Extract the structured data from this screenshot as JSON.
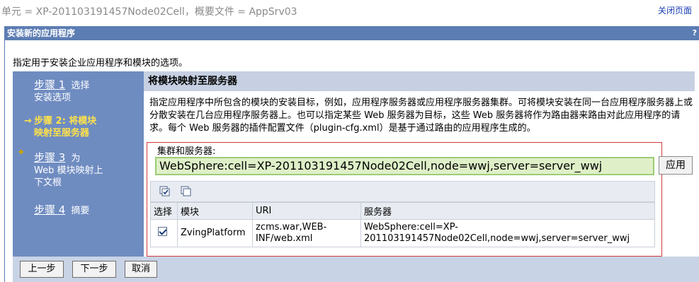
{
  "header": {
    "scope_text": "单元 = XP-201103191457Node02Cell，概要文件 = AppSrv03",
    "close_page": "关闭页面"
  },
  "titlebar": {
    "title": "安装新的应用程序",
    "help": "?"
  },
  "intro": "指定用于安装企业应用程序和模块的选项。",
  "steps": [
    {
      "num": "步骤 1",
      "label_line1": "选择",
      "label_line2": "安装选项"
    },
    {
      "label_line1": "步骤 2: 将模块",
      "label_line2": "映射至服务器",
      "arrow": "→"
    },
    {
      "num": "步骤 3",
      "label_line1": "为",
      "label_line2": "Web 模块映射上",
      "label_line3": "下文根"
    },
    {
      "num": "步骤 4",
      "label_line1": "摘要"
    }
  ],
  "panel": {
    "title": "将模块映射至服务器",
    "description": "指定应用程序中所包含的模块的安装目标，例如，应用程序服务器或应用程序服务器集群。可将模块安装在同一台应用程序服务器上或分散安装在几台应用程序服务器上。也可以指定某些 Web 服务器为目标，这些 Web 服务器将作为路由器来路由对此应用程序的请求。每个 Web 服务器的插件配置文件（plugin-cfg.xml）是基于通过路由的应用程序生成的。"
  },
  "cluster": {
    "label": "集群和服务器:",
    "selected": "WebSphere:cell=XP-201103191457Node02Cell,node=wwj,server=server_wwj",
    "apply": "应用"
  },
  "table": {
    "headers": [
      "选择",
      "模块",
      "URI",
      "服务器"
    ],
    "rows": [
      {
        "module": "ZvingPlatform",
        "uri_line1": "zcms.war,WEB-",
        "uri_line2": "INF/web.xml",
        "server_line1": "WebSphere:cell=XP-",
        "server_line2": "201103191457Node02Cell,node=wwj,server=server_wwj"
      }
    ]
  },
  "buttons": {
    "previous": "上一步",
    "next": "下一步",
    "cancel": "取消"
  },
  "icons": [
    "select-all-icon",
    "deselect-all-icon"
  ],
  "colors": {
    "title_bar": "#5c7db3",
    "steps_bg": "#6f8cc1",
    "current_step": "#ffe24a",
    "highlight_border": "#d43a3a",
    "select_bg": "#dff0c8"
  }
}
